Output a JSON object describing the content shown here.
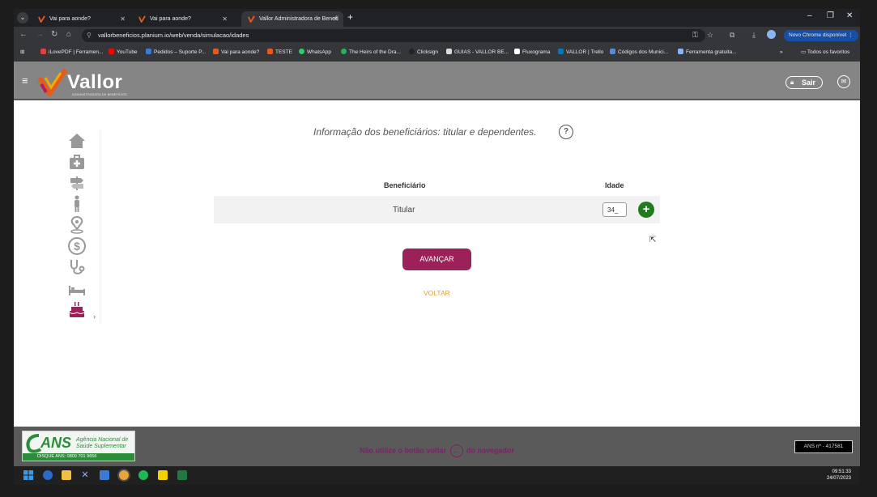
{
  "browser": {
    "tabs": [
      {
        "title": "Vai para aonde?",
        "active": false
      },
      {
        "title": "Vai para aonde?",
        "active": false
      },
      {
        "title": "Vallor Administradora de Benefí",
        "active": true
      }
    ],
    "url": "vallorbeneficios.planium.io/web/venda/simulacao/idades",
    "update_label": "Novo Chrome disponível",
    "bookmarks": [
      "iLovePDF | Ferramen...",
      "YouTube",
      "Pedidos – Suporte P...",
      "Vai para aonde?",
      "TESTE",
      "WhatsApp",
      "The Heirs of the Dra...",
      "Clicksign",
      "GUIAS - VALLOR BE...",
      "Fluxograma",
      "VALLOR | Trello",
      "Códigos dos Munici...",
      "Ferramenta gratuita..."
    ],
    "all_bookmarks": "Todos os favoritos"
  },
  "header": {
    "logo": "Vallor",
    "logo_sub": "ADMINISTRADORA DE BENEFÍCIOS",
    "logout": "Sair"
  },
  "main": {
    "heading": "Informação dos beneficiários: titular e dependentes.",
    "help": "?",
    "table": {
      "col_beneficiary": "Beneficiário",
      "col_age": "Idade",
      "rows": [
        {
          "beneficiary": "Titular",
          "age": "34_"
        }
      ]
    },
    "add_label": "+",
    "next_label": "AVANÇAR",
    "back_label": "VOLTAR"
  },
  "footer": {
    "ans_logo": "ANS",
    "ans_name1": "Agência Nacional de",
    "ans_name2": "Saúde Suplementar",
    "ans_phone": "DISQUE ANS: 0800 701 9656",
    "message_before": "Não utilize o botão voltar",
    "message_after": "do navegador",
    "ans_number": "ANS nº - 417581"
  },
  "taskbar": {
    "time": "09:51:33",
    "date": "24/07/2023"
  },
  "colors": {
    "header_bg": "#858585",
    "primary": "#9c2158",
    "add_green": "#1e7c1e",
    "back_link": "#e0a030",
    "logo_accent": "#e85a1c"
  }
}
